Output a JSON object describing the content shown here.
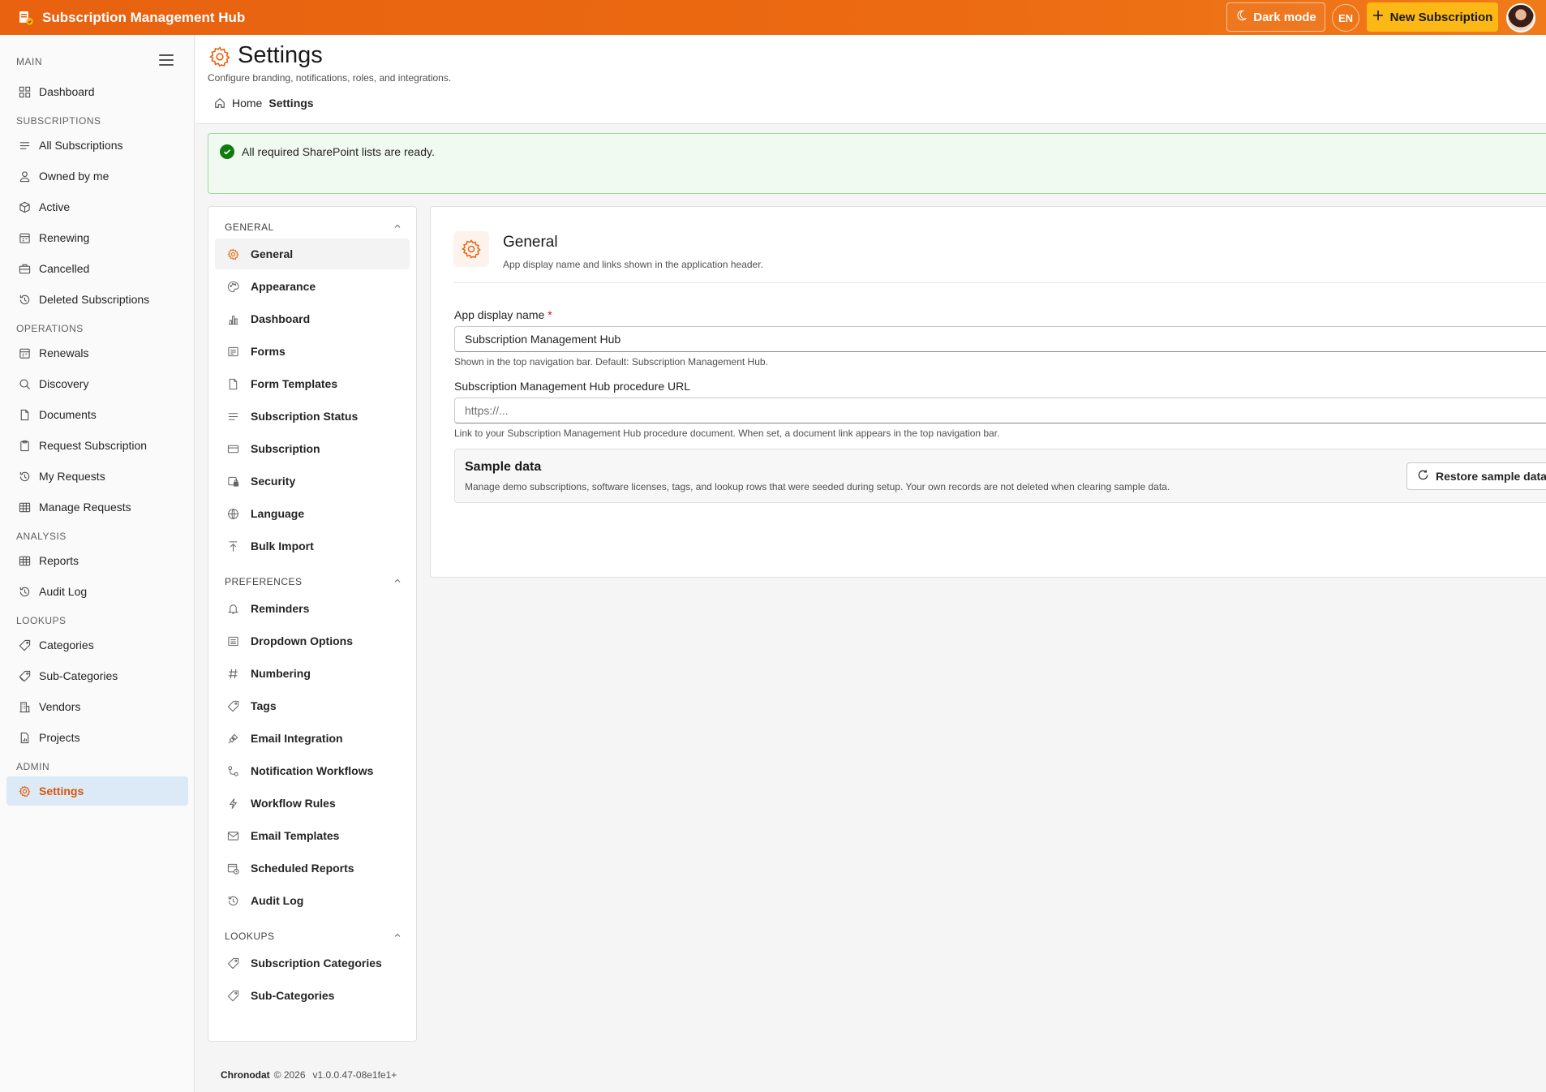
{
  "app": {
    "title": "Subscription Management Hub",
    "dark_mode_label": "Dark mode",
    "language_code": "EN",
    "new_button_label": "New Subscription",
    "accent_color": "#e8620f",
    "cta_color": "#fcb815"
  },
  "sidebar": {
    "sections": [
      {
        "label": "MAIN"
      },
      {
        "label": "SUBSCRIPTIONS"
      },
      {
        "label": "OPERATIONS"
      },
      {
        "label": "ANALYSIS"
      },
      {
        "label": "LOOKUPS"
      },
      {
        "label": "ADMIN"
      }
    ],
    "items": [
      {
        "label": "Dashboard",
        "icon": "grid-icon"
      },
      {
        "label": "All Subscriptions",
        "icon": "list-icon"
      },
      {
        "label": "Owned by me",
        "icon": "person-icon"
      },
      {
        "label": "Active",
        "icon": "box-icon"
      },
      {
        "label": "Renewing",
        "icon": "calendar-icon"
      },
      {
        "label": "Cancelled",
        "icon": "briefcase-icon"
      },
      {
        "label": "Deleted Subscriptions",
        "icon": "history-icon"
      },
      {
        "label": "Renewals",
        "icon": "calendar-icon"
      },
      {
        "label": "Discovery",
        "icon": "search-icon"
      },
      {
        "label": "Documents",
        "icon": "document-icon"
      },
      {
        "label": "Request Subscription",
        "icon": "clipboard-icon"
      },
      {
        "label": "My Requests",
        "icon": "history-icon"
      },
      {
        "label": "Manage Requests",
        "icon": "table-icon"
      },
      {
        "label": "Reports",
        "icon": "table-icon"
      },
      {
        "label": "Audit Log",
        "icon": "history-icon"
      },
      {
        "label": "Categories",
        "icon": "tag-icon"
      },
      {
        "label": "Sub-Categories",
        "icon": "tags-icon"
      },
      {
        "label": "Vendors",
        "icon": "building-icon"
      },
      {
        "label": "Projects",
        "icon": "document-chart-icon"
      },
      {
        "label": "Settings",
        "icon": "gear-icon",
        "active": true
      }
    ]
  },
  "page": {
    "title": "Settings",
    "subtitle": "Configure branding, notifications, roles, and integrations.",
    "breadcrumb_home": "Home",
    "breadcrumb_current": "Settings"
  },
  "alert": {
    "text": "All required SharePoint lists are ready.",
    "status": "success"
  },
  "settings_nav": {
    "groups": [
      {
        "label": "GENERAL"
      },
      {
        "label": "PREFERENCES"
      },
      {
        "label": "LOOKUPS"
      }
    ],
    "items": [
      {
        "label": "General",
        "icon": "gear-icon",
        "active": true
      },
      {
        "label": "Appearance",
        "icon": "palette-icon"
      },
      {
        "label": "Dashboard",
        "icon": "bar-chart-icon"
      },
      {
        "label": "Forms",
        "icon": "form-icon"
      },
      {
        "label": "Form Templates",
        "icon": "document-icon"
      },
      {
        "label": "Subscription Status",
        "icon": "lines-icon"
      },
      {
        "label": "Subscription",
        "icon": "card-icon"
      },
      {
        "label": "Security",
        "icon": "lock-icon"
      },
      {
        "label": "Language",
        "icon": "globe-icon"
      },
      {
        "label": "Bulk Import",
        "icon": "upload-icon"
      },
      {
        "label": "Reminders",
        "icon": "bell-icon"
      },
      {
        "label": "Dropdown Options",
        "icon": "dropdown-icon"
      },
      {
        "label": "Numbering",
        "icon": "hash-icon"
      },
      {
        "label": "Tags",
        "icon": "tag-icon"
      },
      {
        "label": "Email Integration",
        "icon": "plug-icon"
      },
      {
        "label": "Notification Workflows",
        "icon": "flow-icon"
      },
      {
        "label": "Workflow Rules",
        "icon": "flash-icon"
      },
      {
        "label": "Email Templates",
        "icon": "mail-icon"
      },
      {
        "label": "Scheduled Reports",
        "icon": "calendar-clock-icon"
      },
      {
        "label": "Audit Log",
        "icon": "history-icon"
      },
      {
        "label": "Subscription Categories",
        "icon": "tag-icon"
      },
      {
        "label": "Sub-Categories",
        "icon": "tag-icon"
      }
    ]
  },
  "general": {
    "title": "General",
    "subtitle": "App display name and links shown in the application header.",
    "app_name_label": "App display name",
    "required_mark": "*",
    "app_name_value": "Subscription Management Hub",
    "app_name_hint": "Shown in the top navigation bar. Default: Subscription Management Hub.",
    "url_label": "Subscription Management Hub procedure URL",
    "url_placeholder": "https://...",
    "url_value": "",
    "url_hint": "Link to your Subscription Management Hub procedure document. When set, a document link appears in the top navigation bar.",
    "sample_title": "Sample data",
    "sample_desc": "Manage demo subscriptions, software licenses, tags, and lookup rows that were seeded during setup. Your own records are not deleted when clearing sample data.",
    "restore_label": "Restore sample data"
  },
  "footer": {
    "company": "Chronodat",
    "copyright": "© 2026",
    "version": "v1.0.0.47-08e1fe1+"
  }
}
